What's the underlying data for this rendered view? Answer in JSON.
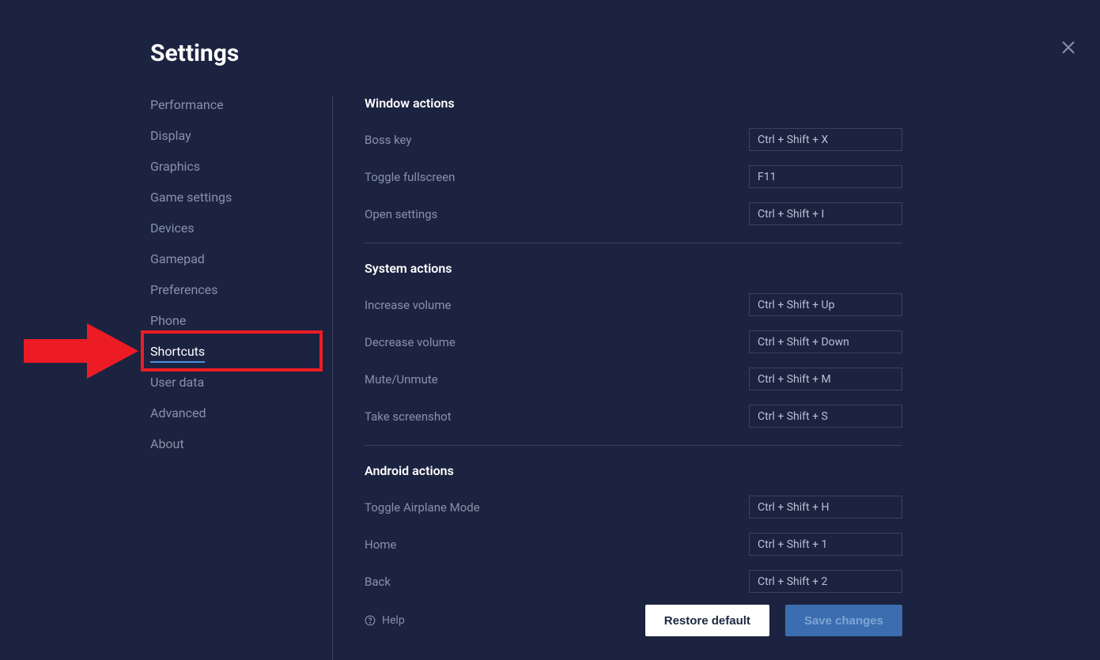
{
  "page_title": "Settings",
  "sidebar": {
    "items": [
      {
        "label": "Performance",
        "active": false
      },
      {
        "label": "Display",
        "active": false
      },
      {
        "label": "Graphics",
        "active": false
      },
      {
        "label": "Game settings",
        "active": false
      },
      {
        "label": "Devices",
        "active": false
      },
      {
        "label": "Gamepad",
        "active": false
      },
      {
        "label": "Preferences",
        "active": false
      },
      {
        "label": "Phone",
        "active": false
      },
      {
        "label": "Shortcuts",
        "active": true
      },
      {
        "label": "User data",
        "active": false
      },
      {
        "label": "Advanced",
        "active": false
      },
      {
        "label": "About",
        "active": false
      }
    ]
  },
  "sections": [
    {
      "title": "Window actions",
      "rows": [
        {
          "label": "Boss key",
          "key": "Ctrl + Shift + X"
        },
        {
          "label": "Toggle fullscreen",
          "key": "F11"
        },
        {
          "label": "Open settings",
          "key": "Ctrl + Shift + I"
        }
      ]
    },
    {
      "title": "System actions",
      "rows": [
        {
          "label": "Increase volume",
          "key": "Ctrl + Shift + Up"
        },
        {
          "label": "Decrease volume",
          "key": "Ctrl + Shift + Down"
        },
        {
          "label": "Mute/Unmute",
          "key": "Ctrl + Shift + M"
        },
        {
          "label": "Take screenshot",
          "key": "Ctrl + Shift + S"
        }
      ]
    },
    {
      "title": "Android actions",
      "rows": [
        {
          "label": "Toggle Airplane Mode",
          "key": "Ctrl + Shift + H"
        },
        {
          "label": "Home",
          "key": "Ctrl + Shift + 1"
        },
        {
          "label": "Back",
          "key": "Ctrl + Shift + 2"
        }
      ]
    }
  ],
  "footer": {
    "help": "Help",
    "restore": "Restore default",
    "save": "Save changes"
  }
}
